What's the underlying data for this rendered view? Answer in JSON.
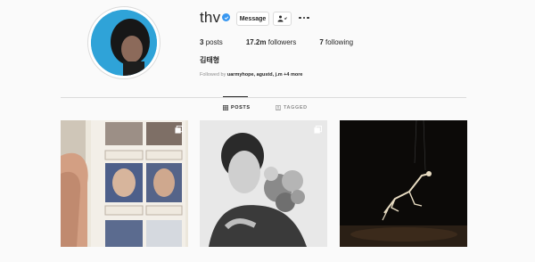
{
  "profile": {
    "username": "thv",
    "message_label": "Message",
    "fullname": "김태형"
  },
  "stats": {
    "posts_count": "3",
    "posts_label": "posts",
    "followers_count": "17.2m",
    "followers_label": "followers",
    "following_count": "7",
    "following_label": "following"
  },
  "followed_by": {
    "prefix": "Followed by",
    "names": "uarmyhope, agustd, j.m",
    "more": "+4 more"
  },
  "tabs": [
    {
      "label": "POSTS",
      "icon": "grid-icon"
    },
    {
      "label": "TAGGED",
      "icon": "tag-icon"
    }
  ],
  "colors": {
    "verified": "#3897f0",
    "background": "#fafafa",
    "text": "#262626",
    "muted": "#8e8e8e"
  }
}
